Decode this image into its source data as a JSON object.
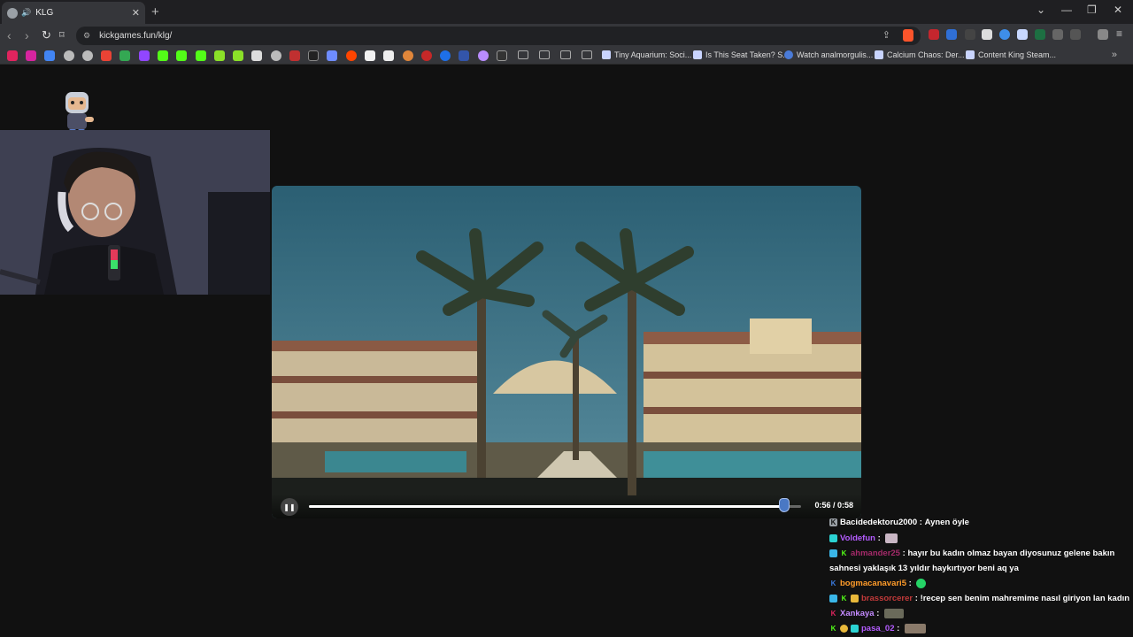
{
  "browser": {
    "tab_title": "KLG",
    "url": "kickgames.fun/klg/",
    "bookmarks": [
      "Tiny Aquarium: Soci...",
      "Is This Seat Taken? S...",
      "Watch analmorgulis...",
      "Calcium Chaos: Der...",
      "Content King Steam..."
    ]
  },
  "video": {
    "time": "0:56 / 0:58",
    "progress": 0.965
  },
  "chat": [
    {
      "user": "Bacidedektoru2000",
      "sep": " : ",
      "text": "Aynen öyle",
      "color": "#ffffff"
    },
    {
      "user": "Voldefun",
      "sep": " : ",
      "text": "",
      "color": "#b45cff"
    },
    {
      "user": "ahmander25",
      "sep": " : ",
      "text": "hayır bu kadın olmaz bayan diyosunuz gelene bakın",
      "color": "#a52a6a"
    },
    {
      "user": "",
      "sep": "",
      "text": "sahnesi yaklaşık 13 yıldır haykırtıyor beni aq ya",
      "color": "#ffffff"
    },
    {
      "user": "bogmacanavari5",
      "sep": " : ",
      "text": "",
      "color": "#ff9c2a"
    },
    {
      "user": "brassorcerer",
      "sep": " : ",
      "text": "!recep sen benim mahremime nasıl giriyon lan kadın",
      "color": "#c23a3a"
    },
    {
      "user": "Xankaya",
      "sep": " : ",
      "text": "",
      "color": "#c48bff"
    },
    {
      "user": "pasa_02",
      "sep": " : ",
      "text": "",
      "color": "#b45cff"
    }
  ]
}
